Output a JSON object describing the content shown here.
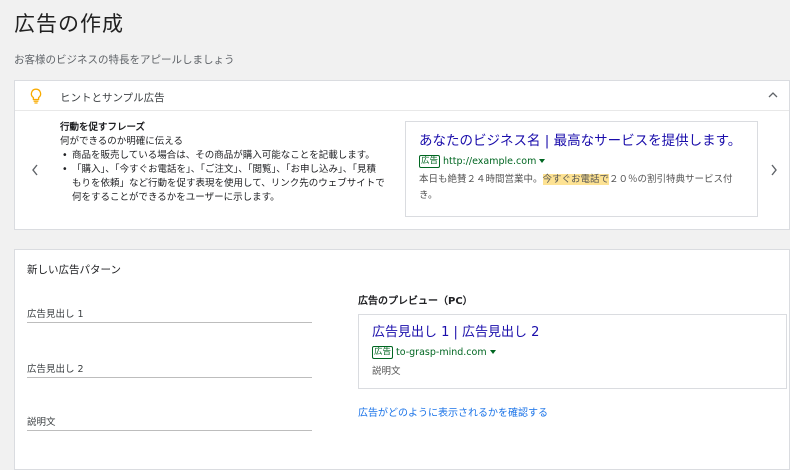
{
  "page": {
    "title": "広告の作成",
    "subtitle": "お客様のビジネスの特長をアピールしましょう"
  },
  "hints": {
    "title": "ヒントとサンプル広告",
    "tip_heading": "行動を促すフレーズ",
    "tip_intro": "何ができるのか明確に伝える",
    "tip_items": [
      "商品を販売している場合は、その商品が購入可能なことを記載します。",
      "「購入」、「今すぐお電話を」、「ご注文」、「閲覧」、「お申し込み」、「見積もりを依頼」など行動を促す表現を使用して、リンク先のウェブサイトで何をすることができるかをユーザーに示します。"
    ],
    "sample_ad": {
      "headline": "あなたのビジネス名 | 最高なサービスを提供します。",
      "badge": "広告",
      "url": "http://example.com",
      "desc_before": "本日も絶賛２４時間営業中。",
      "desc_highlight": "今すぐお電話で",
      "desc_after": "２０％の割引特典サービス付き。"
    }
  },
  "pattern": {
    "title": "新しい広告パターン",
    "fields": [
      {
        "label": "広告見出し 1"
      },
      {
        "label": "広告見出し 2"
      },
      {
        "label": "説明文"
      }
    ],
    "preview": {
      "heading": "広告のプレビュー（PC）",
      "headline": "広告見出し 1 | 広告見出し 2",
      "badge": "広告",
      "url": "to-grasp-mind.com",
      "desc": "説明文",
      "link": "広告がどのように表示されるかを確認する"
    }
  },
  "colors": {
    "link_blue": "#1a0dab",
    "url_green": "#006621",
    "highlight": "#fde293",
    "bulb": "#f9ab00"
  },
  "icons": [
    "lightbulb-icon",
    "chevron-up-icon",
    "chevron-left-icon",
    "chevron-right-icon"
  ]
}
